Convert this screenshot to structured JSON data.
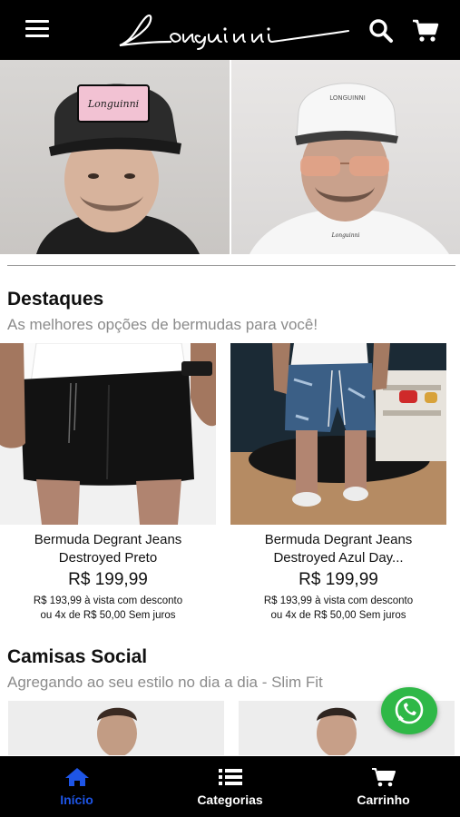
{
  "header": {
    "brand": "Longuinni",
    "menu_icon": "menu-icon",
    "search_icon": "search-icon",
    "cart_icon": "cart-icon"
  },
  "hero": {
    "left_cap_text": "Longuinni",
    "right_cap_text": "LONGUINNI",
    "right_shirt_text": "Longuinni"
  },
  "sections": [
    {
      "title": "Destaques",
      "subtitle": "As melhores opções de bermudas para você!",
      "products": [
        {
          "name_line1": "Bermuda Degrant Jeans",
          "name_line2": "Destroyed Preto",
          "price": "R$ 199,99",
          "note_line1": "R$ 193,99 à vista com desconto",
          "note_line2": "ou 4x de R$ 50,00 Sem juros"
        },
        {
          "name_line1": "Bermuda Degrant Jeans",
          "name_line2": "Destroyed Azul Day...",
          "price": "R$ 199,99",
          "note_line1": "R$ 193,99 à vista com desconto",
          "note_line2": "ou 4x de R$ 50,00 Sem juros"
        }
      ]
    },
    {
      "title": "Camisas Social",
      "subtitle": "Agregando ao seu estilo no dia a dia - Slim Fit"
    }
  ],
  "whatsapp": {
    "icon": "whatsapp-icon",
    "color": "#2fb847"
  },
  "bottom_nav": [
    {
      "label": "Início",
      "icon": "home-icon",
      "active": true
    },
    {
      "label": "Categorias",
      "icon": "list-icon",
      "active": false
    },
    {
      "label": "Carrinho",
      "icon": "cart-icon",
      "active": false
    }
  ],
  "colors": {
    "accent": "#1e55e6",
    "bar": "#000000",
    "subtitle": "#8b8b8b"
  }
}
